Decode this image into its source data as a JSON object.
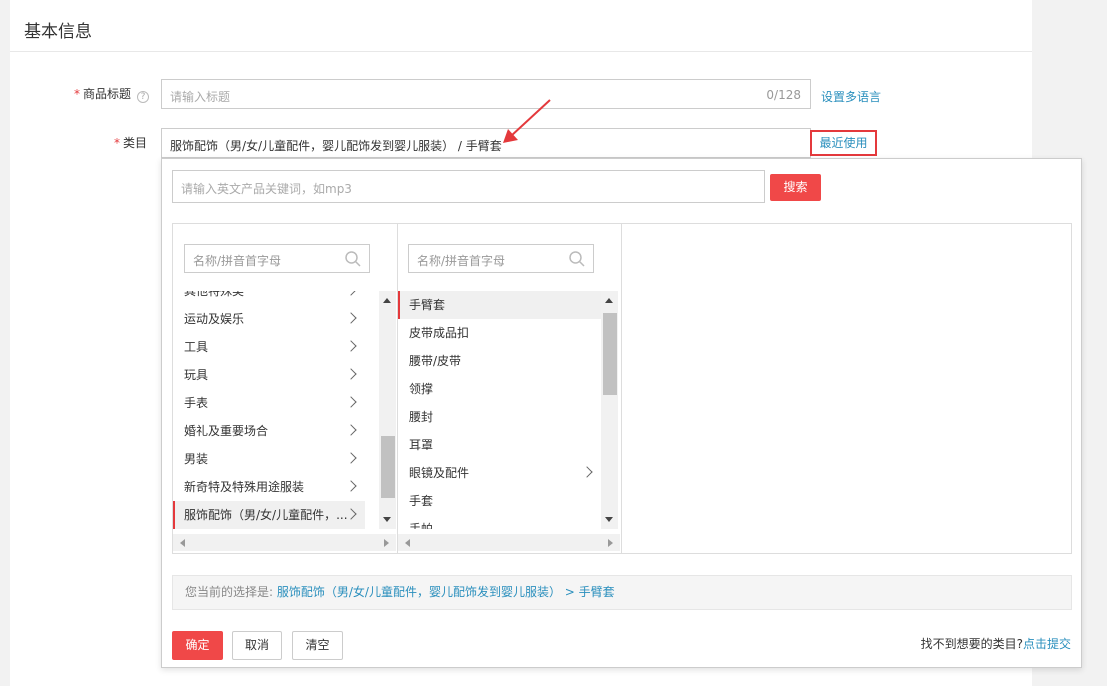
{
  "section": {
    "title": "基本信息"
  },
  "form": {
    "title_label": "商品标题",
    "title_placeholder": "请输入标题",
    "title_counter": "0/128",
    "multi_lang_link": "设置多语言",
    "category_label": "类目",
    "category_value": "服饰配饰（男/女/儿童配件，婴儿配饰发到婴儿服装） / 手臂套",
    "recent_button": "最近使用",
    "required_mark": "*",
    "help_icon": "?"
  },
  "popup": {
    "keyword_placeholder": "请输入英文产品关键词，如mp3",
    "search_button": "搜索",
    "col1": {
      "filter_placeholder": "名称/拼音首字母",
      "items": [
        {
          "label": "其他特殊类",
          "has_children": true,
          "selected": false
        },
        {
          "label": "运动及娱乐",
          "has_children": true,
          "selected": false
        },
        {
          "label": "工具",
          "has_children": true,
          "selected": false
        },
        {
          "label": "玩具",
          "has_children": true,
          "selected": false
        },
        {
          "label": "手表",
          "has_children": true,
          "selected": false
        },
        {
          "label": "婚礼及重要场合",
          "has_children": true,
          "selected": false
        },
        {
          "label": "男装",
          "has_children": true,
          "selected": false
        },
        {
          "label": "新奇特及特殊用途服装",
          "has_children": true,
          "selected": false
        },
        {
          "label": "服饰配饰（男/女/儿童配件，...",
          "has_children": true,
          "selected": true
        }
      ]
    },
    "col2": {
      "filter_placeholder": "名称/拼音首字母",
      "items": [
        {
          "label": "手臂套",
          "has_children": false,
          "selected": true
        },
        {
          "label": "皮带成品扣",
          "has_children": false,
          "selected": false
        },
        {
          "label": "腰带/皮带",
          "has_children": false,
          "selected": false
        },
        {
          "label": "领撑",
          "has_children": false,
          "selected": false
        },
        {
          "label": "腰封",
          "has_children": false,
          "selected": false
        },
        {
          "label": "耳罩",
          "has_children": false,
          "selected": false
        },
        {
          "label": "眼镜及配件",
          "has_children": true,
          "selected": false
        },
        {
          "label": "手套",
          "has_children": false,
          "selected": false
        },
        {
          "label": "手帕",
          "has_children": false,
          "selected": false
        }
      ]
    },
    "current_prefix": "您当前的选择是:",
    "current_path": "服饰配饰（男/女/儿童配件，婴儿配饰发到婴儿服装） > 手臂套",
    "confirm_button": "确定",
    "cancel_button": "取消",
    "clear_button": "清空",
    "not_found_text": "找不到想要的类目?",
    "submit_link": "点击提交"
  },
  "colors": {
    "accent_red": "#f04848",
    "link_blue": "#2a8fbd",
    "annotation_red": "#e4393c"
  }
}
